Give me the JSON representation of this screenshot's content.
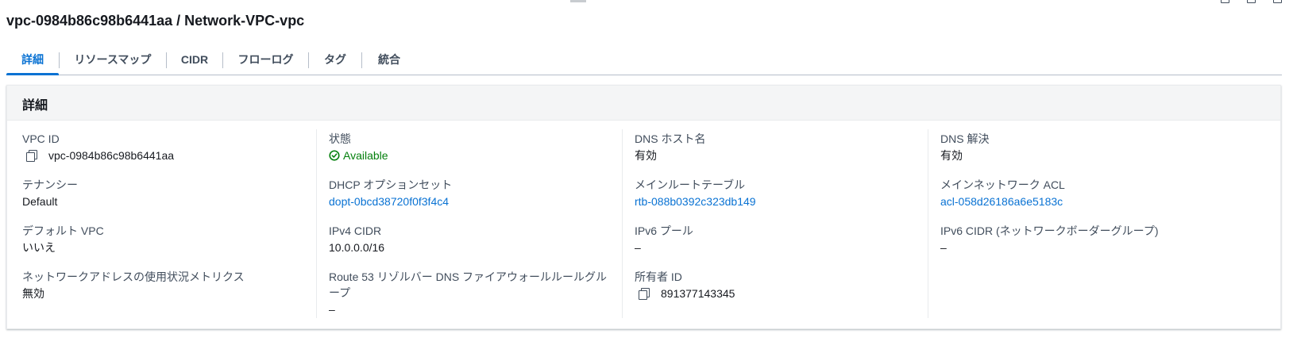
{
  "page": {
    "title": "vpc-0984b86c98b6441aa / Network-VPC-vpc"
  },
  "tabs": [
    {
      "label": "詳細",
      "active": true
    },
    {
      "label": "リソースマップ"
    },
    {
      "label": "CIDR"
    },
    {
      "label": "フローログ"
    },
    {
      "label": "タグ"
    },
    {
      "label": "統合"
    }
  ],
  "details": {
    "title": "詳細",
    "columns": [
      [
        {
          "label": "VPC ID",
          "value": "vpc-0984b86c98b6441aa",
          "copyable": true
        },
        {
          "label": "テナンシー",
          "value": "Default"
        },
        {
          "label": "デフォルト VPC",
          "value": "いいえ"
        },
        {
          "label": "ネットワークアドレスの使用状況メトリクス",
          "value": "無効"
        }
      ],
      [
        {
          "label": "状態",
          "value": "Available",
          "status": "success"
        },
        {
          "label": "DHCP オプションセット",
          "value": "dopt-0bcd38720f0f3f4c4",
          "link": true
        },
        {
          "label": "IPv4 CIDR",
          "value": "10.0.0.0/16"
        },
        {
          "label": "Route 53 リゾルバー DNS ファイアウォールルールグループ",
          "value": "–"
        }
      ],
      [
        {
          "label": "DNS ホスト名",
          "value": "有効"
        },
        {
          "label": "メインルートテーブル",
          "value": "rtb-088b0392c323db149",
          "link": true
        },
        {
          "label": "IPv6 プール",
          "value": "–"
        },
        {
          "label": "所有者 ID",
          "value": "891377143345",
          "copyable": true
        }
      ],
      [
        {
          "label": "DNS 解決",
          "value": "有効"
        },
        {
          "label": "メインネットワーク ACL",
          "value": "acl-058d26186a6e5183c",
          "link": true
        },
        {
          "label": "IPv6 CIDR (ネットワークボーダーグループ)",
          "value": "–"
        }
      ]
    ]
  },
  "colors": {
    "link": "#0972d3",
    "success": "#037f0c",
    "text": "#16191f",
    "label": "#414d5c"
  },
  "icons": {
    "copy": "copy-icon",
    "status": "status-positive-icon"
  }
}
